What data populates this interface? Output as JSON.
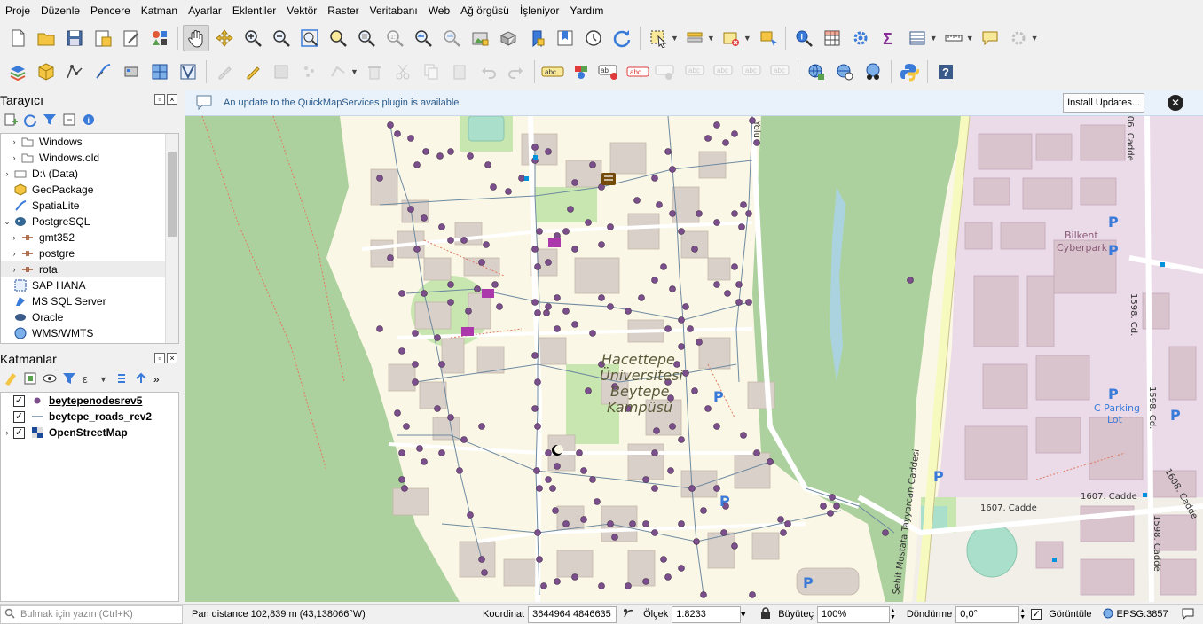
{
  "menu": [
    "Proje",
    "Düzenle",
    "Pencere",
    "Katman",
    "Ayarlar",
    "Eklentiler",
    "Vektör",
    "Raster",
    "Veritabanı",
    "Web",
    "Ağ örgüsü",
    "İşleniyor",
    "Yardım"
  ],
  "browser_panel": {
    "title": "Tarayıcı",
    "items": [
      {
        "label": "Windows",
        "indent": 1,
        "arrow": "›",
        "icon": "folder-icon"
      },
      {
        "label": "Windows.old",
        "indent": 1,
        "arrow": "›",
        "icon": "folder-icon"
      },
      {
        "label": "D:\\ (Data)",
        "indent": 0,
        "arrow": "›",
        "icon": "drive-icon"
      },
      {
        "label": "GeoPackage",
        "indent": 0,
        "arrow": "",
        "icon": "geopackage-icon"
      },
      {
        "label": "SpatiaLite",
        "indent": 0,
        "arrow": "",
        "icon": "spatialite-icon"
      },
      {
        "label": "PostgreSQL",
        "indent": 0,
        "arrow": "⌄",
        "icon": "postgresql-icon"
      },
      {
        "label": "gmt352",
        "indent": 1,
        "arrow": "›",
        "icon": "connection-icon"
      },
      {
        "label": "postgre",
        "indent": 1,
        "arrow": "›",
        "icon": "connection-icon"
      },
      {
        "label": "rota",
        "indent": 1,
        "arrow": "›",
        "icon": "connection-icon"
      },
      {
        "label": "SAP HANA",
        "indent": 0,
        "arrow": "",
        "icon": "saphana-icon"
      },
      {
        "label": "MS SQL Server",
        "indent": 0,
        "arrow": "",
        "icon": "mssql-icon"
      },
      {
        "label": "Oracle",
        "indent": 0,
        "arrow": "",
        "icon": "oracle-icon"
      },
      {
        "label": "WMS/WMTS",
        "indent": 0,
        "arrow": "",
        "icon": "wms-icon"
      }
    ]
  },
  "layers_panel": {
    "title": "Katmanlar",
    "layers": [
      {
        "name": "beytepenodesrev5",
        "checked": true,
        "icon": "point-layer-icon",
        "underline": true
      },
      {
        "name": "beytepe_roads_rev2",
        "checked": true,
        "icon": "line-layer-icon",
        "underline": false
      },
      {
        "name": "OpenStreetMap",
        "checked": true,
        "icon": "raster-layer-icon",
        "underline": false
      }
    ]
  },
  "message_bar": {
    "text": "An update to the QuickMapServices plugin is available",
    "button": "Install Updates..."
  },
  "map": {
    "labels": {
      "campus_1": "Hacettepe",
      "campus_2": "Üniversitesi",
      "campus_3": "Beytepe",
      "campus_4": "Kampüsü",
      "cyberpark_1": "Bilkent",
      "cyberpark_2": "Cyberpark",
      "parking_1": "C Parking",
      "parking_2": "Lot",
      "road_1607": "1607. Cadde",
      "road_1607b": "1607. Cadde",
      "road_1598": "1598. Cd.",
      "road_1598b": "1598. Cd.",
      "road_1598c": "1598. Cadde",
      "road_1606": "1606. Cadde",
      "road_1608": "1608. Cadde",
      "road_sehit": "Şehit Mustafa Tayyarcan Caddesi",
      "road_yolu": "Yolu",
      "parking_p": "P"
    },
    "colors": {
      "forest": "#add19e",
      "campus": "#fbf7e6",
      "industrial": "#ebdbe8",
      "building": "#d9d0c9",
      "node": "#7b4e8c",
      "road": "#ffffff",
      "major_road": "#f7fabf"
    }
  },
  "status_bar": {
    "search_placeholder": "Bulmak için yazın (Ctrl+K)",
    "message": "Pan distance 102,839 m (43,138066°W)",
    "coord_label": "Koordinat",
    "coord_value": "3644964 4846635",
    "scale_label": "Ölçek",
    "scale_value": "1:8233",
    "magnifier_label": "Büyüteç",
    "magnifier_value": "100%",
    "rotation_label": "Döndürme",
    "rotation_value": "0,0°",
    "render_label": "Görüntüle",
    "crs": "EPSG:3857"
  }
}
